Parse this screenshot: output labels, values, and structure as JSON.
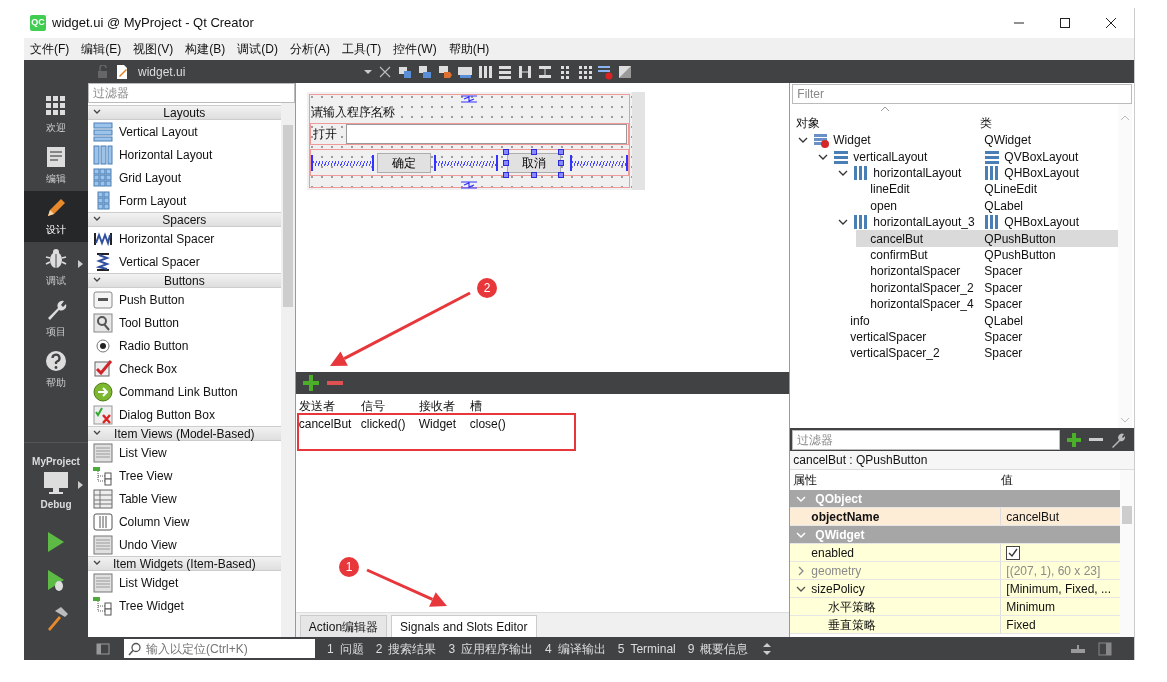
{
  "window": {
    "icon_text": "QC",
    "title": "widget.ui @ MyProject - Qt Creator"
  },
  "menu": [
    "文件(F)",
    "编辑(E)",
    "视图(V)",
    "构建(B)",
    "调试(D)",
    "分析(A)",
    "工具(T)",
    "控件(W)",
    "帮助(H)"
  ],
  "editor_toolbar": {
    "file": "widget.ui"
  },
  "modes": [
    {
      "label": "欢迎",
      "kind": "welcome",
      "selected": false,
      "submenu": false
    },
    {
      "label": "编辑",
      "kind": "edit",
      "selected": false,
      "submenu": false
    },
    {
      "label": "设计",
      "kind": "design",
      "selected": true,
      "submenu": false
    },
    {
      "label": "调试",
      "kind": "debug",
      "selected": false,
      "submenu": true
    },
    {
      "label": "项目",
      "kind": "projects",
      "selected": false,
      "submenu": false
    },
    {
      "label": "帮助",
      "kind": "help",
      "selected": false,
      "submenu": false
    }
  ],
  "kit": {
    "project": "MyProject",
    "config": "Debug"
  },
  "widget_box": {
    "placeholder": "过滤器",
    "categories": [
      {
        "title": "Layouts",
        "expanded": true,
        "items": [
          {
            "label": "Vertical Layout",
            "kind": "vlayout"
          },
          {
            "label": "Horizontal Layout",
            "kind": "hlayout"
          },
          {
            "label": "Grid Layout",
            "kind": "grid"
          },
          {
            "label": "Form Layout",
            "kind": "form"
          }
        ]
      },
      {
        "title": "Spacers",
        "expanded": true,
        "items": [
          {
            "label": "Horizontal Spacer",
            "kind": "hspacer"
          },
          {
            "label": "Vertical Spacer",
            "kind": "vspacer"
          }
        ]
      },
      {
        "title": "Buttons",
        "expanded": true,
        "items": [
          {
            "label": "Push Button",
            "kind": "push"
          },
          {
            "label": "Tool Button",
            "kind": "tool"
          },
          {
            "label": "Radio Button",
            "kind": "radio"
          },
          {
            "label": "Check Box",
            "kind": "check"
          },
          {
            "label": "Command Link Button",
            "kind": "link"
          },
          {
            "label": "Dialog Button Box",
            "kind": "dialog"
          }
        ]
      },
      {
        "title": "Item Views (Model-Based)",
        "expanded": true,
        "items": [
          {
            "label": "List View",
            "kind": "list"
          },
          {
            "label": "Tree View",
            "kind": "tree"
          },
          {
            "label": "Table View",
            "kind": "table"
          },
          {
            "label": "Column View",
            "kind": "column"
          },
          {
            "label": "Undo View",
            "kind": "list"
          }
        ]
      },
      {
        "title": "Item Widgets (Item-Based)",
        "expanded": true,
        "items": [
          {
            "label": "List Widget",
            "kind": "list"
          },
          {
            "label": "Tree Widget",
            "kind": "tree"
          }
        ]
      }
    ]
  },
  "form": {
    "prompt": "请输入程序名称",
    "open_label": "打开",
    "buttons": [
      {
        "label": "确定",
        "selected": false
      },
      {
        "label": "取消",
        "selected": true
      }
    ]
  },
  "signals_slots": {
    "columns": [
      "发送者",
      "信号",
      "接收者",
      "槽"
    ],
    "rows": [
      [
        "cancelBut",
        "clicked()",
        "Widget",
        "close()"
      ]
    ]
  },
  "bottom_tabs": [
    {
      "label": "Action编辑器",
      "selected": false
    },
    {
      "label": "Signals and Slots Editor",
      "selected": true
    }
  ],
  "object_inspector": {
    "placeholder": "Filter",
    "columns": [
      "对象",
      "类"
    ],
    "tree": [
      {
        "name": "Widget",
        "class": "QWidget",
        "kind": "widget",
        "expanded": true,
        "selected": false,
        "children": [
          {
            "name": "verticalLayout",
            "class": "QVBoxLayout",
            "kind": "vbox",
            "expanded": true,
            "selected": false,
            "children": [
              {
                "name": "horizontalLayout",
                "class": "QHBoxLayout",
                "kind": "hbox",
                "expanded": true,
                "selected": false,
                "children": [
                  {
                    "name": "lineEdit",
                    "class": "QLineEdit",
                    "selected": false
                  },
                  {
                    "name": "open",
                    "class": "QLabel",
                    "selected": false
                  }
                ]
              },
              {
                "name": "horizontalLayout_3",
                "class": "QHBoxLayout",
                "kind": "hbox",
                "expanded": true,
                "selected": false,
                "children": [
                  {
                    "name": "cancelBut",
                    "class": "QPushButton",
                    "selected": true
                  },
                  {
                    "name": "confirmBut",
                    "class": "QPushButton",
                    "selected": false
                  },
                  {
                    "name": "horizontalSpacer",
                    "class": "Spacer",
                    "selected": false
                  },
                  {
                    "name": "horizontalSpacer_2",
                    "class": "Spacer",
                    "selected": false
                  },
                  {
                    "name": "horizontalSpacer_4",
                    "class": "Spacer",
                    "selected": false
                  }
                ]
              },
              {
                "name": "info",
                "class": "QLabel",
                "selected": false
              },
              {
                "name": "verticalSpacer",
                "class": "Spacer",
                "selected": false
              },
              {
                "name": "verticalSpacer_2",
                "class": "Spacer",
                "selected": false
              }
            ]
          }
        ]
      }
    ]
  },
  "property_editor": {
    "placeholder": "过滤器",
    "title": "cancelBut : QPushButton",
    "columns": [
      "属性",
      "值"
    ],
    "groups": [
      {
        "name": "QObject",
        "expanded": true,
        "properties": [
          {
            "name": "objectName",
            "value": "cancelBut",
            "bold": true
          }
        ]
      },
      {
        "name": "QWidget",
        "expanded": true,
        "properties": [
          {
            "name": "enabled",
            "kind": "checkbox",
            "checked": true
          },
          {
            "name": "geometry",
            "value": "[(207, 1), 60 x 23]",
            "disabled": true,
            "expanded": false
          },
          {
            "name": "sizePolicy",
            "value": "[Minimum, Fixed, ...",
            "expanded": true,
            "children": [
              {
                "name": "水平策略",
                "value": "Minimum"
              },
              {
                "name": "垂直策略",
                "value": "Fixed"
              }
            ]
          }
        ]
      }
    ]
  },
  "status_bar": {
    "placeholder": "输入以定位(Ctrl+K)",
    "panes": [
      {
        "number": "1",
        "label": "问题"
      },
      {
        "number": "2",
        "label": "搜索结果"
      },
      {
        "number": "3",
        "label": "应用程序输出"
      },
      {
        "number": "4",
        "label": "编译输出"
      },
      {
        "number": "5",
        "label": "Terminal"
      },
      {
        "number": "9",
        "label": "概要信息"
      }
    ]
  },
  "annotations": [
    {
      "kind": "frame"
    },
    {
      "kind": "callout",
      "label": "2"
    },
    {
      "kind": "callout",
      "label": "1"
    }
  ]
}
